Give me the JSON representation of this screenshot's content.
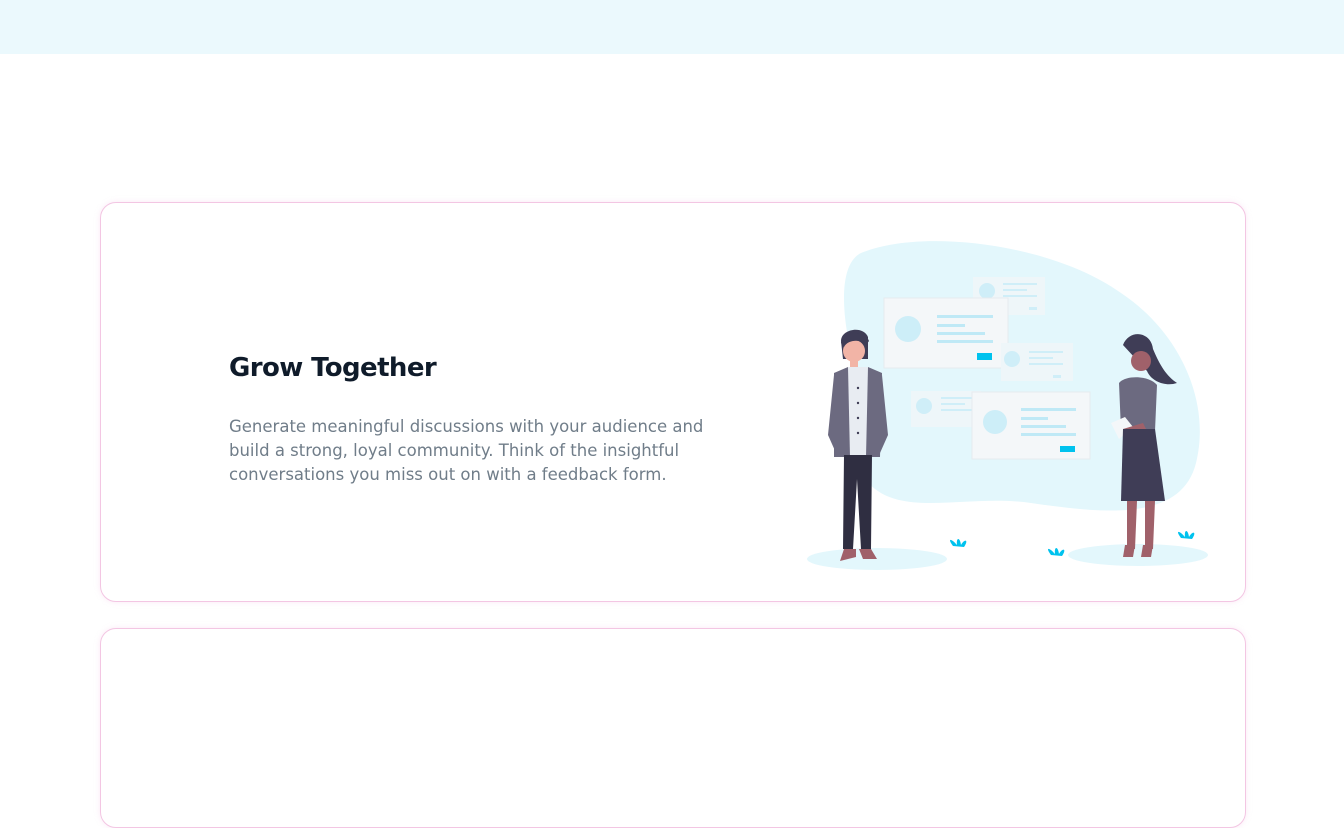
{
  "feature_card": {
    "title": "Grow Together",
    "description": "Generate meaningful discussions with your audience and build a strong, loyal community. Think of the insightful conversations you miss out on with a feedback form."
  },
  "colors": {
    "top_band": "#ebf9fd",
    "card_border": "#f3c6e3",
    "title_text": "#0f1b2a",
    "body_text": "#707d89",
    "accent": "#00c2ee",
    "blob": "#e3f7fc"
  },
  "illustration": {
    "icon": "community-discussion-illustration"
  }
}
